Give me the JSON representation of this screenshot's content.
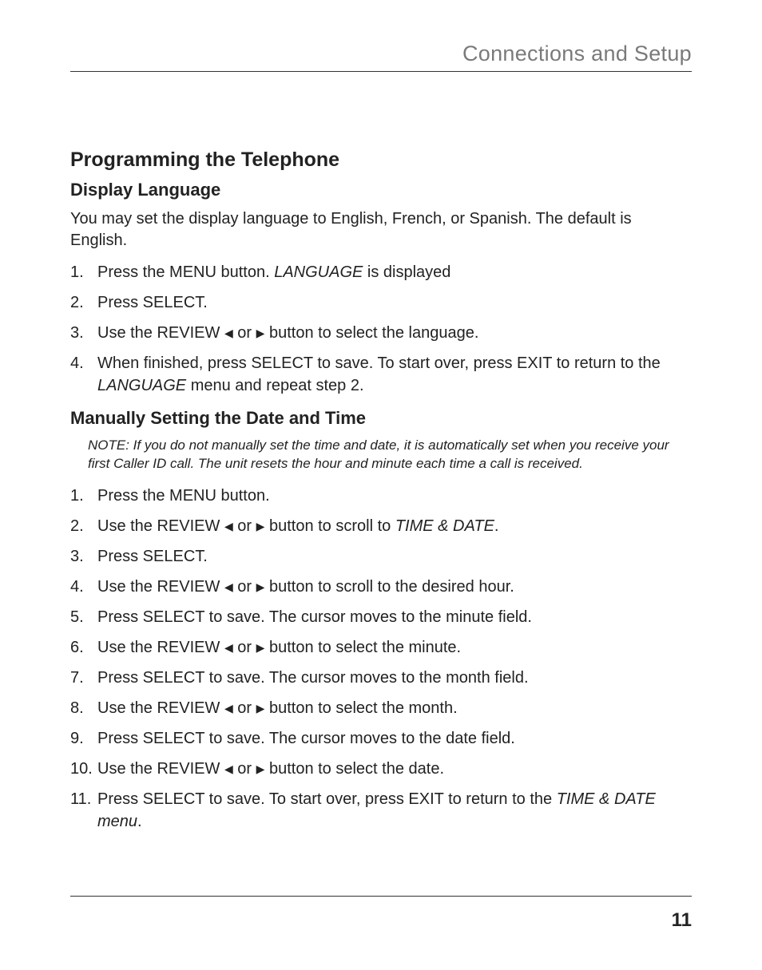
{
  "header": {
    "title": "Connections and Setup"
  },
  "section": {
    "heading": "Programming the Telephone"
  },
  "display_language": {
    "heading": "Display Language",
    "intro": "You may set the display language to English, French, or Spanish. The default is English.",
    "steps": [
      {
        "num": "1.",
        "pre": "Press the MENU button. ",
        "italic": "LANGUAGE",
        "post": " is displayed"
      },
      {
        "num": "2.",
        "pre": "Press SELECT.",
        "italic": "",
        "post": ""
      },
      {
        "num": "3.",
        "pre": "Use the REVIEW ",
        "arrows": true,
        "post": " button to select the language."
      },
      {
        "num": "4.",
        "pre": "When finished, press SELECT to save. To start over, press EXIT to return to the ",
        "italic": "LANGUAGE",
        "post": " menu and repeat step 2."
      }
    ]
  },
  "manual_date_time": {
    "heading": "Manually Setting the Date and Time",
    "note": "NOTE: If you do not manually set the time and date, it is automatically set when you receive your first Caller ID call. The unit resets the hour and minute each time a call is received.",
    "steps": [
      {
        "num": "1.",
        "pre": "Press the MENU button.",
        "italic": "",
        "post": ""
      },
      {
        "num": "2.",
        "pre": "Use the REVIEW ",
        "arrows": true,
        "mid": " button to scroll to ",
        "italic": "TIME & DATE",
        "post": "."
      },
      {
        "num": "3.",
        "pre": "Press SELECT.",
        "italic": "",
        "post": ""
      },
      {
        "num": "4.",
        "pre": "Use the REVIEW ",
        "arrows": true,
        "post": " button to scroll to the desired hour."
      },
      {
        "num": "5.",
        "pre": "Press SELECT to save. The cursor moves to the minute field.",
        "italic": "",
        "post": ""
      },
      {
        "num": "6.",
        "pre": "Use the REVIEW ",
        "arrows": true,
        "post": " button to select the minute."
      },
      {
        "num": "7.",
        "pre": "Press SELECT to save. The cursor moves to the month field.",
        "italic": "",
        "post": ""
      },
      {
        "num": "8.",
        "pre": "Use the REVIEW ",
        "arrows": true,
        "post": " button to select the month."
      },
      {
        "num": "9.",
        "pre": "Press SELECT to save. The cursor moves to the date field.",
        "italic": "",
        "post": ""
      },
      {
        "num": "10.",
        "pre": "Use the REVIEW ",
        "arrows": true,
        "post": " button to select the date."
      },
      {
        "num": "11.",
        "pre": "Press SELECT to save. To start over, press EXIT to return to the ",
        "italic": "TIME & DATE menu",
        "post": "."
      }
    ]
  },
  "arrows": {
    "left": "◀",
    "or": " or ",
    "right": "▶"
  },
  "footer": {
    "page": "11"
  }
}
